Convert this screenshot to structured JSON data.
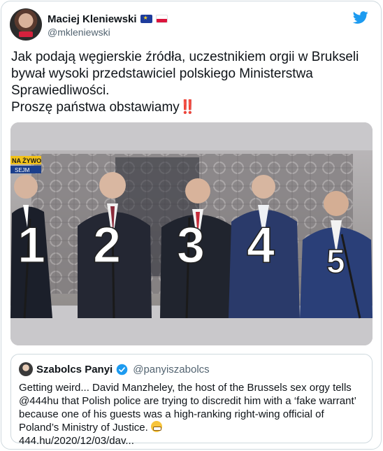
{
  "author": {
    "display_name": "Maciej Kleniewski",
    "handle": "@mkleniewski",
    "flags": [
      "eu-flag-icon",
      "poland-flag-icon"
    ]
  },
  "tweet": {
    "lines": [
      "Jak podają węgierskie źródła, uczestnikiem orgii w Brukseli",
      "bywał wysoki przedstawiciel polskiego Ministerstwa",
      "Sprawiedliwości.",
      "Proszę państwa obstawiamy"
    ],
    "emoji": "‼️"
  },
  "media": {
    "overlay_tv": "NA ŻYWO",
    "overlay_sejm": "SEJM",
    "numbers": [
      "1",
      "2",
      "3",
      "4",
      "5"
    ]
  },
  "quoted": {
    "display_name": "Szabolcs Panyi",
    "handle": "@panyiszabolcs",
    "lines": [
      "Getting weird... David Manzheley, the host of the Brussels sex orgy tells",
      "@444hu that Polish police are trying to discredit him with a ‘fake warrant’",
      "because one of his guests was a high-ranking right-wing official of",
      "Poland’s Ministry of Justice.",
      "444.hu/2020/12/03/dav..."
    ]
  },
  "colors": {
    "twitter_blue": "#1d9bf0",
    "text_primary": "#0f1419",
    "text_secondary": "#536471",
    "border": "#cfd9de"
  },
  "icons": {
    "brand": "twitter-bird-icon",
    "verified": "verified-badge-icon",
    "emoji_bangbang": "double-exclamation-icon",
    "emoji_grimace": "grimacing-face-icon"
  }
}
